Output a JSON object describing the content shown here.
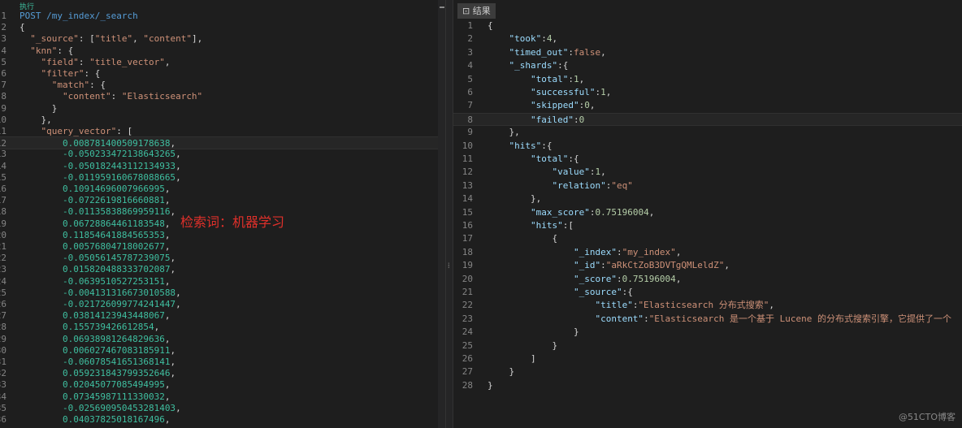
{
  "request": {
    "run_label": "执行",
    "lines": [
      [
        [
          "kw",
          "POST"
        ],
        [
          "p",
          " "
        ],
        [
          "path",
          "/my_index/_search"
        ]
      ],
      [
        [
          "p",
          "{"
        ]
      ],
      [
        [
          "p",
          "  "
        ],
        [
          "k",
          "\"_source\""
        ],
        [
          "p",
          ": ["
        ],
        [
          "s",
          "\"title\""
        ],
        [
          "p",
          ", "
        ],
        [
          "s",
          "\"content\""
        ],
        [
          "p",
          "],"
        ]
      ],
      [
        [
          "p",
          "  "
        ],
        [
          "k",
          "\"knn\""
        ],
        [
          "p",
          ": {"
        ]
      ],
      [
        [
          "p",
          "    "
        ],
        [
          "k",
          "\"field\""
        ],
        [
          "p",
          ": "
        ],
        [
          "s",
          "\"title_vector\""
        ],
        [
          "p",
          ","
        ]
      ],
      [
        [
          "p",
          "    "
        ],
        [
          "k",
          "\"filter\""
        ],
        [
          "p",
          ": {"
        ]
      ],
      [
        [
          "p",
          "      "
        ],
        [
          "k",
          "\"match\""
        ],
        [
          "p",
          ": {"
        ]
      ],
      [
        [
          "p",
          "        "
        ],
        [
          "k",
          "\"content\""
        ],
        [
          "p",
          ": "
        ],
        [
          "s",
          "\"Elasticsearch\""
        ]
      ],
      [
        [
          "p",
          "      }"
        ]
      ],
      [
        [
          "p",
          "    },"
        ]
      ],
      [
        [
          "p",
          "    "
        ],
        [
          "k",
          "\"query_vector\""
        ],
        [
          "p",
          ": ["
        ]
      ],
      [
        [
          "p",
          "        "
        ],
        [
          "n",
          "0.008781400509178638"
        ],
        [
          "p",
          ","
        ]
      ],
      [
        [
          "p",
          "        "
        ],
        [
          "n",
          "-0.050233472138643265"
        ],
        [
          "p",
          ","
        ]
      ],
      [
        [
          "p",
          "        "
        ],
        [
          "n",
          "-0.050182443112134933"
        ],
        [
          "p",
          ","
        ]
      ],
      [
        [
          "p",
          "        "
        ],
        [
          "n",
          "-0.011959160678088665"
        ],
        [
          "p",
          ","
        ]
      ],
      [
        [
          "p",
          "        "
        ],
        [
          "n",
          "0.10914696007966995"
        ],
        [
          "p",
          ","
        ]
      ],
      [
        [
          "p",
          "        "
        ],
        [
          "n",
          "-0.0722619816660881"
        ],
        [
          "p",
          ","
        ]
      ],
      [
        [
          "p",
          "        "
        ],
        [
          "n",
          "-0.01135838869959116"
        ],
        [
          "p",
          ","
        ]
      ],
      [
        [
          "p",
          "        "
        ],
        [
          "n",
          "0.06728864461183548"
        ],
        [
          "p",
          ","
        ]
      ],
      [
        [
          "p",
          "        "
        ],
        [
          "n",
          "0.11854641884565353"
        ],
        [
          "p",
          ","
        ]
      ],
      [
        [
          "p",
          "        "
        ],
        [
          "n",
          "0.00576804718002677"
        ],
        [
          "p",
          ","
        ]
      ],
      [
        [
          "p",
          "        "
        ],
        [
          "n",
          "-0.05056145787239075"
        ],
        [
          "p",
          ","
        ]
      ],
      [
        [
          "p",
          "        "
        ],
        [
          "n",
          "0.015820488333702087"
        ],
        [
          "p",
          ","
        ]
      ],
      [
        [
          "p",
          "        "
        ],
        [
          "n",
          "-0.0639510527253151"
        ],
        [
          "p",
          ","
        ]
      ],
      [
        [
          "p",
          "        "
        ],
        [
          "n",
          "-0.004131316673010588"
        ],
        [
          "p",
          ","
        ]
      ],
      [
        [
          "p",
          "        "
        ],
        [
          "n",
          "-0.021726099774241447"
        ],
        [
          "p",
          ","
        ]
      ],
      [
        [
          "p",
          "        "
        ],
        [
          "n",
          "0.03814123943448067"
        ],
        [
          "p",
          ","
        ]
      ],
      [
        [
          "p",
          "        "
        ],
        [
          "n",
          "0.155739426612854"
        ],
        [
          "p",
          ","
        ]
      ],
      [
        [
          "p",
          "        "
        ],
        [
          "n",
          "0.06938981264829636"
        ],
        [
          "p",
          ","
        ]
      ],
      [
        [
          "p",
          "        "
        ],
        [
          "n",
          "0.006027467083185911"
        ],
        [
          "p",
          ","
        ]
      ],
      [
        [
          "p",
          "        "
        ],
        [
          "n",
          "-0.06078541651368141"
        ],
        [
          "p",
          ","
        ]
      ],
      [
        [
          "p",
          "        "
        ],
        [
          "n",
          "0.059231843799352646"
        ],
        [
          "p",
          ","
        ]
      ],
      [
        [
          "p",
          "        "
        ],
        [
          "n",
          "0.02045077085494995"
        ],
        [
          "p",
          ","
        ]
      ],
      [
        [
          "p",
          "        "
        ],
        [
          "n",
          "0.07345987111330032"
        ],
        [
          "p",
          ","
        ]
      ],
      [
        [
          "p",
          "        "
        ],
        [
          "n",
          "-0.025690950453281403"
        ],
        [
          "p",
          ","
        ]
      ],
      [
        [
          "p",
          "        "
        ],
        [
          "n",
          "0.04037825018167496"
        ],
        [
          "p",
          ","
        ]
      ]
    ]
  },
  "annotation": "检索词：机器学习",
  "response": {
    "tab_label": "结果",
    "lines": [
      [
        [
          "p",
          "{"
        ]
      ],
      [
        [
          "p",
          "    "
        ],
        [
          "k",
          "\"took\""
        ],
        [
          "p",
          ":"
        ],
        [
          "n",
          "4"
        ],
        [
          "p",
          ","
        ]
      ],
      [
        [
          "p",
          "    "
        ],
        [
          "k",
          "\"timed_out\""
        ],
        [
          "p",
          ":"
        ],
        [
          "b",
          "false"
        ],
        [
          "p",
          ","
        ]
      ],
      [
        [
          "p",
          "    "
        ],
        [
          "k",
          "\"_shards\""
        ],
        [
          "p",
          ":{"
        ]
      ],
      [
        [
          "p",
          "        "
        ],
        [
          "k",
          "\"total\""
        ],
        [
          "p",
          ":"
        ],
        [
          "n",
          "1"
        ],
        [
          "p",
          ","
        ]
      ],
      [
        [
          "p",
          "        "
        ],
        [
          "k",
          "\"successful\""
        ],
        [
          "p",
          ":"
        ],
        [
          "n",
          "1"
        ],
        [
          "p",
          ","
        ]
      ],
      [
        [
          "p",
          "        "
        ],
        [
          "k",
          "\"skipped\""
        ],
        [
          "p",
          ":"
        ],
        [
          "n",
          "0"
        ],
        [
          "p",
          ","
        ]
      ],
      [
        [
          "p",
          "        "
        ],
        [
          "k",
          "\"failed\""
        ],
        [
          "p",
          ":"
        ],
        [
          "n",
          "0"
        ]
      ],
      [
        [
          "p",
          "    },"
        ]
      ],
      [
        [
          "p",
          "    "
        ],
        [
          "k",
          "\"hits\""
        ],
        [
          "p",
          ":{"
        ]
      ],
      [
        [
          "p",
          "        "
        ],
        [
          "k",
          "\"total\""
        ],
        [
          "p",
          ":{"
        ]
      ],
      [
        [
          "p",
          "            "
        ],
        [
          "k",
          "\"value\""
        ],
        [
          "p",
          ":"
        ],
        [
          "n",
          "1"
        ],
        [
          "p",
          ","
        ]
      ],
      [
        [
          "p",
          "            "
        ],
        [
          "k",
          "\"relation\""
        ],
        [
          "p",
          ":"
        ],
        [
          "s",
          "\"eq\""
        ]
      ],
      [
        [
          "p",
          "        },"
        ]
      ],
      [
        [
          "p",
          "        "
        ],
        [
          "k",
          "\"max_score\""
        ],
        [
          "p",
          ":"
        ],
        [
          "n",
          "0.75196004"
        ],
        [
          "p",
          ","
        ]
      ],
      [
        [
          "p",
          "        "
        ],
        [
          "k",
          "\"hits\""
        ],
        [
          "p",
          ":["
        ]
      ],
      [
        [
          "p",
          "            {"
        ]
      ],
      [
        [
          "p",
          "                "
        ],
        [
          "k",
          "\"_index\""
        ],
        [
          "p",
          ":"
        ],
        [
          "s",
          "\"my_index\""
        ],
        [
          "p",
          ","
        ]
      ],
      [
        [
          "p",
          "                "
        ],
        [
          "k",
          "\"_id\""
        ],
        [
          "p",
          ":"
        ],
        [
          "s",
          "\"aRkCtZoB3DVTgQMLeldZ\""
        ],
        [
          "p",
          ","
        ]
      ],
      [
        [
          "p",
          "                "
        ],
        [
          "k",
          "\"_score\""
        ],
        [
          "p",
          ":"
        ],
        [
          "n",
          "0.75196004"
        ],
        [
          "p",
          ","
        ]
      ],
      [
        [
          "p",
          "                "
        ],
        [
          "k",
          "\"_source\""
        ],
        [
          "p",
          ":{"
        ]
      ],
      [
        [
          "p",
          "                    "
        ],
        [
          "k",
          "\"title\""
        ],
        [
          "p",
          ":"
        ],
        [
          "s",
          "\"Elasticsearch 分布式搜索\""
        ],
        [
          "p",
          ","
        ]
      ],
      [
        [
          "p",
          "                    "
        ],
        [
          "k",
          "\"content\""
        ],
        [
          "p",
          ":"
        ],
        [
          "s",
          "\"Elasticsearch 是一个基于 Lucene 的分布式搜索引擎，它提供了一个"
        ]
      ],
      [
        [
          "p",
          "                }"
        ]
      ],
      [
        [
          "p",
          "            }"
        ]
      ],
      [
        [
          "p",
          "        ]"
        ]
      ],
      [
        [
          "p",
          "    }"
        ]
      ],
      [
        [
          "p",
          "}"
        ]
      ]
    ]
  },
  "watermark": "@51CTO博客"
}
